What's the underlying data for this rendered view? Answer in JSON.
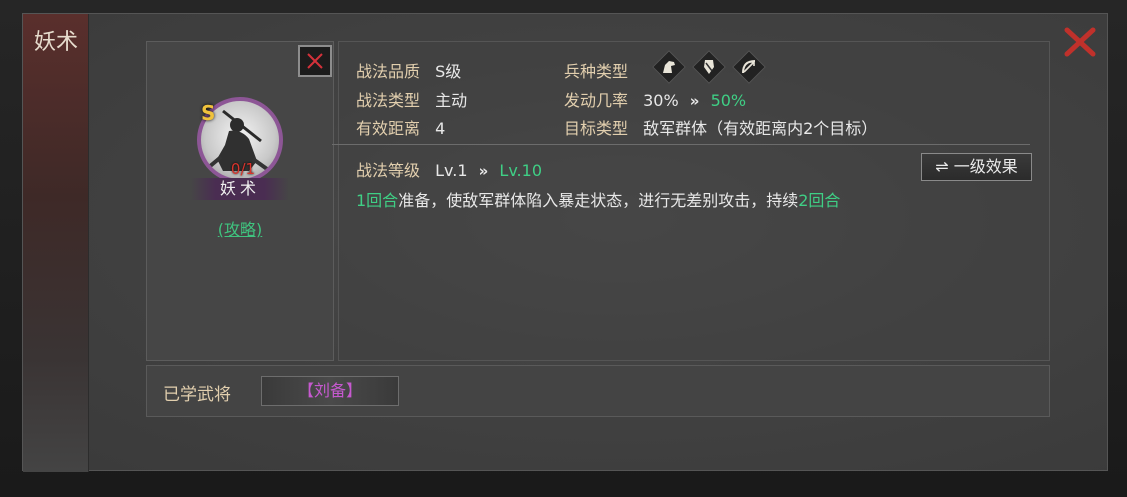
{
  "dialog": {
    "title": "妖术",
    "close_icon": "close-icon"
  },
  "skill_card": {
    "grade_letter": "S",
    "count": "0/1",
    "name": "妖术",
    "strategy_link": "(攻略)",
    "close_icon": "close-icon"
  },
  "details": {
    "quality_label": "战法品质",
    "quality_value": "S级",
    "type_label": "战法类型",
    "type_value": "主动",
    "range_label": "有效距离",
    "range_value": "4",
    "troop_label": "兵种类型",
    "troop_icons": [
      "cavalry-icon",
      "shield-icon",
      "archer-icon"
    ],
    "rate_label": "发动几率",
    "rate_base": "30%",
    "rate_max": "50%",
    "target_label": "目标类型",
    "target_value": "敌军群体（有效距离内2个目标）",
    "level_label": "战法等级",
    "level_base": "Lv.1",
    "level_max": "Lv.10",
    "effect_button": "一级效果",
    "desc_prefix": "1回合",
    "desc_middle": "准备，使敌军群体陷入暴走状态，进行无差别攻击，持续",
    "desc_suffix": "2回合"
  },
  "learned": {
    "label": "已学武将",
    "generals": [
      "【刘备】"
    ]
  },
  "colors": {
    "accent_green": "#3fcf85",
    "close_red": "#c0312b",
    "general_purple": "#c659cf",
    "label_gold": "#e2cfae"
  }
}
